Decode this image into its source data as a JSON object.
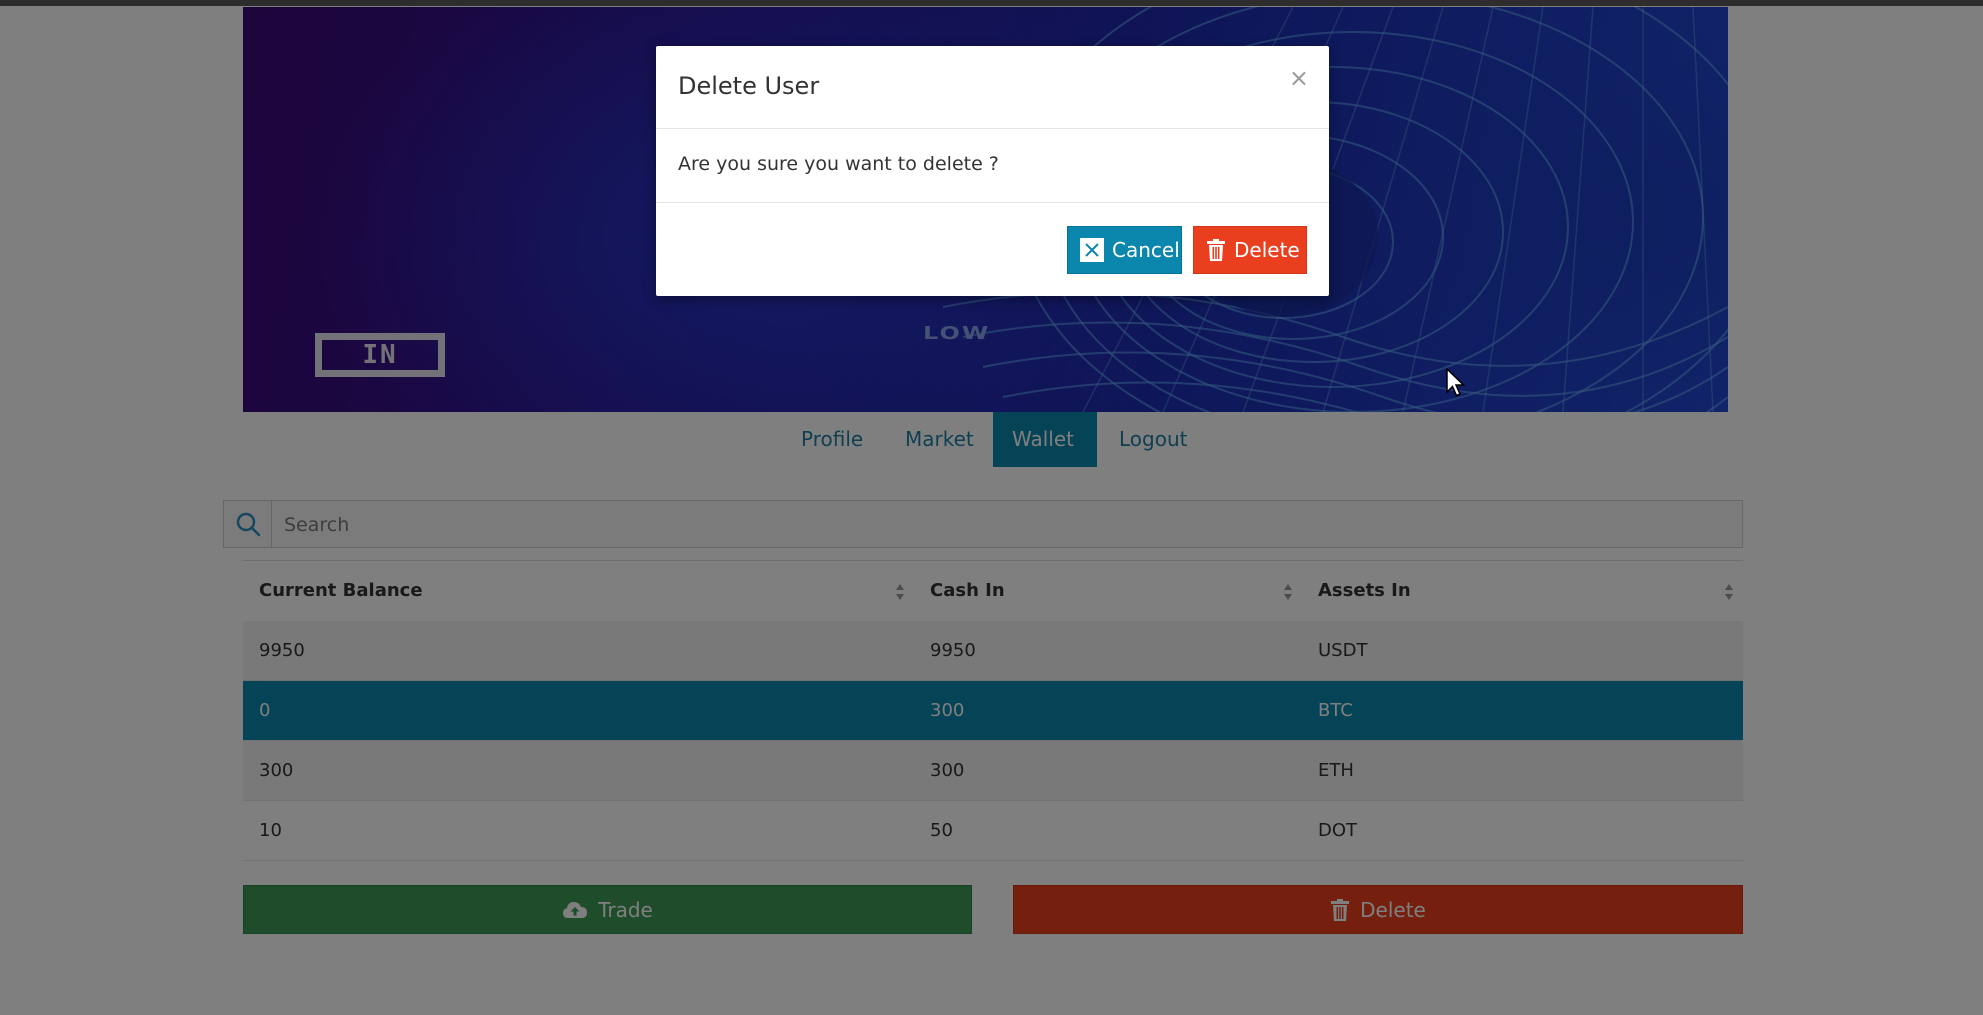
{
  "nav": {
    "items": [
      {
        "label": "Profile"
      },
      {
        "label": "Market"
      },
      {
        "label": "Wallet",
        "active": true
      },
      {
        "label": "Logout"
      }
    ]
  },
  "banner": {
    "logo_text": "IN",
    "sign_text": "LOW"
  },
  "search": {
    "placeholder": "Search",
    "icon": "search-icon"
  },
  "table": {
    "columns": [
      "Current Balance",
      "Cash In",
      "Assets In"
    ],
    "rows": [
      [
        "9950",
        "9950",
        "USDT"
      ],
      [
        "0",
        "300",
        "BTC"
      ],
      [
        "300",
        "300",
        "ETH"
      ],
      [
        "10",
        "50",
        "DOT"
      ]
    ],
    "selected_row": "BTC"
  },
  "actions": {
    "trade_label": "Trade",
    "trade_icon": "cloud-upload-icon",
    "delete_label": "Delete",
    "delete_icon": "trash-icon"
  },
  "modal": {
    "title": "Delete User",
    "close": "×",
    "message": "Are you sure you want to delete ?",
    "cancel_label": "Cancel",
    "delete_label": "Delete"
  },
  "colors": {
    "primary": "#0b86ad",
    "success": "#3f9b57",
    "danger": "#ea3f1f"
  }
}
